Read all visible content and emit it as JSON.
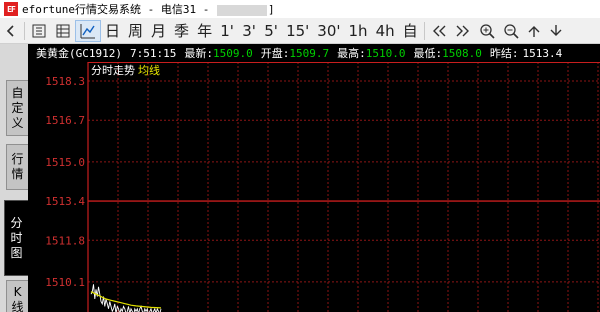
{
  "titlebar": {
    "icon": "EF",
    "title_prefix": "efortune行情交易系统 - 电信31 - ",
    "title_suffix": "]"
  },
  "toolbar": {
    "period_buttons": [
      "日",
      "周",
      "月",
      "季",
      "年",
      "1'",
      "3'",
      "5'",
      "15'",
      "30'",
      "1h",
      "4h",
      "自"
    ],
    "icons": {
      "back": "arrow-left-icon",
      "tick_list": "tick-list-icon",
      "trades_list": "trades-list-icon",
      "minute_chart": "minute-chart-icon",
      "page_left": "double-chevron-left-icon",
      "page_right": "double-chevron-right-icon",
      "zoom_in": "zoom-in-icon",
      "zoom_out": "zoom-out-icon",
      "up": "arrow-up-icon",
      "down": "arrow-down-icon"
    }
  },
  "sidetabs": [
    {
      "label": [
        "自",
        "定",
        "义"
      ],
      "active": false
    },
    {
      "label": [
        "行",
        "情"
      ],
      "active": false
    },
    {
      "label": [
        "分",
        "时",
        "图"
      ],
      "active": true
    },
    {
      "label": [
        "K",
        "线"
      ],
      "active": false
    }
  ],
  "info": {
    "symbol": "美黄金(GC1912)",
    "time": "7:51:15",
    "latest_label": "最新:",
    "latest_value": "1509.0",
    "open_label": "开盘:",
    "open_value": "1509.7",
    "high_label": "最高:",
    "high_value": "1510.0",
    "low_label": "最低:",
    "low_value": "1508.0",
    "prev_close_label": "昨结:",
    "prev_close_value": "1513.4"
  },
  "plot": {
    "subtitle": "分时走势",
    "avg_label": "均线",
    "y_ticks": [
      "1518.3",
      "1516.7",
      "1515.0",
      "1513.4",
      "1511.8",
      "1510.1"
    ],
    "colors": {
      "grid": "#8c1515",
      "frame": "#c81e1e",
      "label": "#d03030",
      "price_line": "#ffffff",
      "avg_line": "#e0e000",
      "subtitle": "#ffffff",
      "avg_label": "#e8e800"
    }
  },
  "chart_data": {
    "type": "line",
    "title": "分时走势",
    "ylim": [
      1508.5,
      1518.3
    ],
    "reference": 1513.4,
    "series": [
      {
        "name": "分时走势",
        "x": [
          0,
          1,
          2,
          3,
          4,
          5,
          6,
          7,
          8,
          9,
          10,
          11,
          12,
          13,
          14,
          15,
          16,
          17,
          18,
          19,
          20,
          21,
          22,
          23,
          24,
          25,
          26,
          27,
          28,
          29,
          30,
          31,
          32,
          33,
          34,
          35,
          36,
          37,
          38,
          39,
          40,
          41,
          42,
          43,
          44,
          45,
          46,
          47,
          48,
          49,
          50,
          51,
          52,
          53,
          54,
          55,
          56
        ],
        "values": [
          1509.6,
          1509.7,
          1510.0,
          1509.4,
          1509.8,
          1509.5,
          1509.9,
          1509.6,
          1509.3,
          1509.2,
          1509.5,
          1509.1,
          1509.4,
          1509.2,
          1509.0,
          1509.3,
          1509.1,
          1508.9,
          1509.0,
          1509.2,
          1508.8,
          1509.1,
          1509.0,
          1508.8,
          1509.0,
          1508.9,
          1509.1,
          1509.0,
          1508.8,
          1508.9,
          1509.1,
          1508.8,
          1509.0,
          1508.9,
          1508.7,
          1509.0,
          1508.9,
          1509.0,
          1508.8,
          1509.0,
          1509.1,
          1508.9,
          1508.8,
          1509.0,
          1508.9,
          1509.0,
          1508.7,
          1508.9,
          1509.0,
          1508.8,
          1508.9,
          1509.0,
          1508.8,
          1509.0,
          1508.9,
          1508.8,
          1509.0
        ]
      },
      {
        "name": "均线",
        "x": [
          0,
          4,
          8,
          12,
          16,
          20,
          24,
          28,
          32,
          36,
          40,
          44,
          48,
          52,
          56
        ],
        "values": [
          1509.7,
          1509.6,
          1509.5,
          1509.4,
          1509.35,
          1509.3,
          1509.25,
          1509.2,
          1509.15,
          1509.12,
          1509.1,
          1509.08,
          1509.06,
          1509.05,
          1509.04
        ]
      }
    ]
  }
}
